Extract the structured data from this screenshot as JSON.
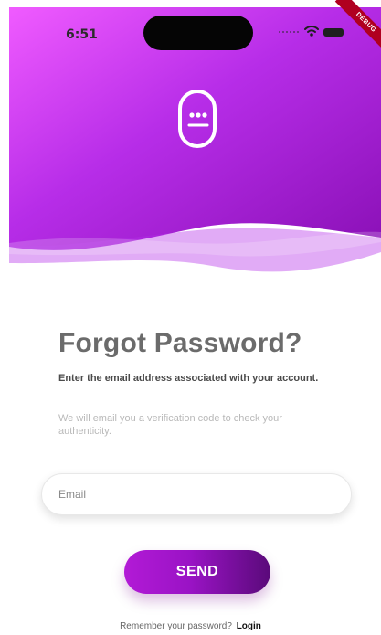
{
  "status_bar": {
    "time": "6:51"
  },
  "debug_badge": {
    "label": "DEBUG"
  },
  "theme": {
    "primary_light": "#e35aff",
    "primary": "#9e1ed6",
    "primary_dark": "#6c0b8f"
  },
  "forgot_password": {
    "title": "Forgot Password?",
    "subtitle": "Enter the email address associated with your account.",
    "helper": "We will email you a verification code to check your authenticity.",
    "email_placeholder": "Email",
    "send_label": "SEND",
    "footer_prompt": "Remember your password?",
    "login_label": "Login"
  },
  "icons": {
    "logo": "robot-face-icon",
    "wifi": "wifi-icon",
    "battery": "battery-icon",
    "signal": "signal-icon"
  }
}
